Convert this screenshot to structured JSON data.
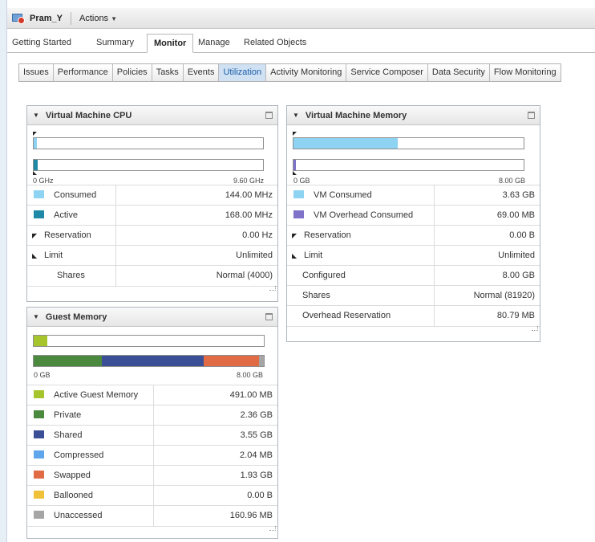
{
  "header": {
    "vm_name": "Pram_Y",
    "actions_label": "Actions"
  },
  "main_tabs": [
    "Getting Started",
    "Summary",
    "Monitor",
    "Manage",
    "Related Objects"
  ],
  "sub_tabs": [
    "Issues",
    "Performance",
    "Policies",
    "Tasks",
    "Events",
    "Utilization",
    "Activity Monitoring",
    "Service Composer",
    "Data Security",
    "Flow Monitoring"
  ],
  "colors": {
    "consumed": "#8ed3f2",
    "active": "#1e8aa8",
    "vm_consumed": "#8ed3f2",
    "vm_overhead": "#7e72c9",
    "active_guest": "#a6c42c",
    "private": "#4b8a3e",
    "shared": "#3a4f95",
    "compressed": "#5fa6ec",
    "swapped": "#e06b45",
    "ballooned": "#f0c23a",
    "unaccessed": "#a5a5a5"
  },
  "cpu": {
    "title": "Virtual Machine CPU",
    "axis_min": "0 GHz",
    "axis_max": "9.60 GHz",
    "consumed_fraction": 0.015,
    "active_fraction": 0.0175,
    "rows": [
      {
        "label": "Consumed",
        "value": "144.00 MHz"
      },
      {
        "label": "Active",
        "value": "168.00 MHz"
      },
      {
        "label": "Reservation",
        "value": "0.00 Hz"
      },
      {
        "label": "Limit",
        "value": "Unlimited"
      },
      {
        "label": "Shares",
        "value": "Normal (4000)"
      }
    ]
  },
  "vm_memory": {
    "title": "Virtual Machine Memory",
    "axis_min": "0 GB",
    "axis_max": "8.00 GB",
    "consumed_fraction": 0.454,
    "overhead_fraction": 0.009,
    "rows": [
      {
        "label": "VM Consumed",
        "value": "3.63 GB"
      },
      {
        "label": "VM Overhead Consumed",
        "value": "69.00 MB"
      },
      {
        "label": "Reservation",
        "value": "0.00 B"
      },
      {
        "label": "Limit",
        "value": "Unlimited"
      },
      {
        "label": "Configured",
        "value": "8.00 GB"
      },
      {
        "label": "Shares",
        "value": "Normal (81920)"
      },
      {
        "label": "Overhead Reservation",
        "value": "80.79 MB"
      }
    ]
  },
  "guest_memory": {
    "title": "Guest Memory",
    "axis_min": "0 GB",
    "axis_max": "8.00 GB",
    "active_fraction": 0.06,
    "segments": {
      "private": 0.295,
      "shared": 0.444,
      "compressed": 0.0003,
      "swapped": 0.241,
      "ballooned": 0.0,
      "unaccessed": 0.02
    },
    "rows": [
      {
        "label": "Active Guest Memory",
        "value": "491.00 MB"
      },
      {
        "label": "Private",
        "value": "2.36 GB"
      },
      {
        "label": "Shared",
        "value": "3.55 GB"
      },
      {
        "label": "Compressed",
        "value": "2.04 MB"
      },
      {
        "label": "Swapped",
        "value": "1.93 GB"
      },
      {
        "label": "Ballooned",
        "value": "0.00 B"
      },
      {
        "label": "Unaccessed",
        "value": "160.96 MB"
      }
    ]
  }
}
